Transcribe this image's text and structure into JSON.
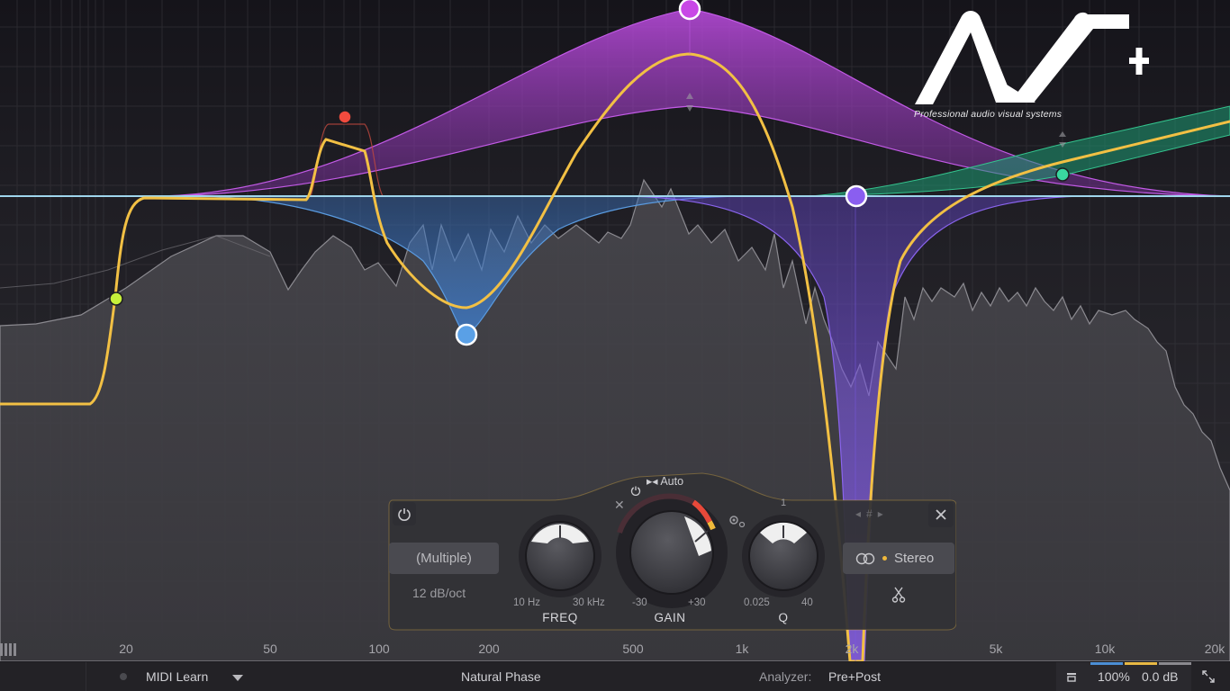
{
  "logo": {
    "tagline": "Professional audio visual systems"
  },
  "frequency_axis": {
    "labels": [
      "20",
      "50",
      "100",
      "200",
      "500",
      "1k",
      "2k",
      "5k",
      "10k",
      "20k"
    ]
  },
  "band_panel": {
    "shape": "(Multiple)",
    "slope": "12 dB/oct",
    "auto_label": "Auto",
    "freq": {
      "title": "FREQ",
      "min": "10 Hz",
      "max": "30 kHz"
    },
    "gain": {
      "title": "GAIN",
      "min": "-30",
      "max": "+30"
    },
    "q": {
      "title": "Q",
      "min": "0.025",
      "max": "40",
      "center": "1"
    },
    "channel": "Stereo",
    "nav_glyphs": "◂#▸"
  },
  "bottom_bar": {
    "midi_learn": "MIDI Learn",
    "phase_mode": "Natural Phase",
    "analyzer_label": "Analyzer:",
    "analyzer_value": "Pre+Post",
    "zoom": "100%",
    "output_gain": "0.0 dB"
  },
  "colors": {
    "background": "#1d1c20",
    "curve": "#f2c044",
    "band_lowcut": "#c6f03a",
    "band_peak_red": "#f24b3e",
    "band_bell_blue": "#5aa0e6",
    "band_bell_magenta": "#c848e6",
    "band_notch_violet": "#8a5ef0",
    "band_highshelf_green": "#3ad6a0"
  }
}
